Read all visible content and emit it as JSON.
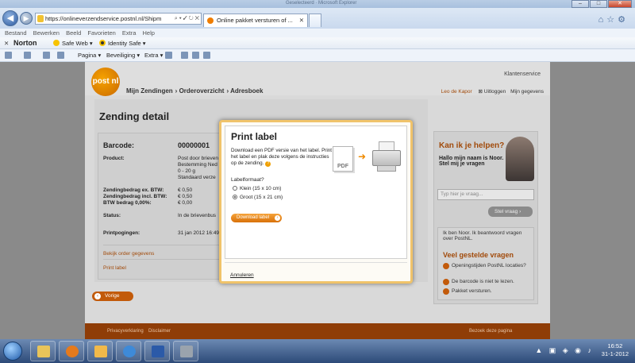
{
  "browser": {
    "window_title": "Geselecteerd · Microsoft Explorer",
    "address_url": "https://onlineverzendservice.postnl.nl/Shipm",
    "address_host_part": "postnl.nl",
    "tab_active": "Online pakket versturen of ...",
    "menu": [
      "Bestand",
      "Bewerken",
      "Beeld",
      "Favorieten",
      "Extra",
      "Help"
    ],
    "norton": {
      "brand": "Norton",
      "safe_web": "Safe Web",
      "identity_safe": "Identity Safe"
    },
    "commands": [
      "Pagina",
      "Beveiliging",
      "Extra"
    ]
  },
  "site": {
    "logo": "post nl",
    "klantenservice": "Klantenservice",
    "nav": [
      "Mijn Zendingen",
      "Orderoverzicht",
      "Adresboek"
    ],
    "user": {
      "name": "Leo de Kapor",
      "logout": "Uitloggen",
      "account": "Mijn gegevens"
    }
  },
  "detail": {
    "title": "Zending detail",
    "barcode_label": "Barcode:",
    "barcode": "00000001",
    "product_label": "Product:",
    "product_lines": [
      "Post door brieven",
      "Bestemming Ned",
      "0 - 20 g",
      "Standaard verze"
    ],
    "bedrag_ex_label": "Zendingbedrag ex. BTW:",
    "bedrag_ex": "€ 0,50",
    "bedrag_incl_label": "Zendingbedrag incl. BTW:",
    "bedrag_incl": "€ 0,50",
    "btw_label": "BTW bedrag 0,00%:",
    "btw": "€ 0,00",
    "status_label": "Status:",
    "status": "In de brievenbus",
    "pogingen_label": "Printpogingen:",
    "pogingen": "31 jan 2012 16:49",
    "bekijk": "Bekijk order gegevens",
    "print_label_link": "Print label",
    "vorige": "Vorige"
  },
  "help": {
    "title": "Kan ik je helpen?",
    "intro": "Hallo mijn naam is Noor. Stel mij je vragen",
    "input_placeholder": "Typ hier je vraag...",
    "ask_button": "Stel vraag",
    "noor_text": "Ik ben Noor. Ik beantwoord vragen over PostNL.",
    "faq_title": "Veel gestelde vragen",
    "faq": [
      "Openingstijden PostNL locaties?",
      "De barcode is niet te lezen.",
      "Pakket versturen."
    ]
  },
  "footer": {
    "privacy": "Privacyverklaring",
    "disclaimer": "Disclaimer",
    "right": "Bezoek deze pagina"
  },
  "modal": {
    "title": "Print label",
    "description": "Download een PDF versie van het label. Print het label en plak deze volgens de instructies op de zending.",
    "pdf_label": "PDF",
    "format_label": "Labelformaat?",
    "options": [
      "Klein (15 x 10 cm)",
      "Groot (15 x 21 cm)"
    ],
    "selected_index": 1,
    "download_button": "Download label",
    "cancel": "Annuleren"
  },
  "taskbar": {
    "time": "16:52",
    "date": "31-1-2012"
  },
  "colors": {
    "postnl_orange": "#ef7d00",
    "link_brown": "#a14a0a",
    "footer": "#8f3d07"
  }
}
